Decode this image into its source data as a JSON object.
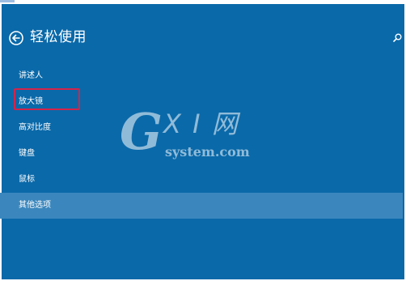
{
  "header": {
    "title": "轻松使用",
    "back_icon": "back-arrow-icon",
    "search_icon": "search-icon"
  },
  "menu": {
    "items": [
      {
        "label": "讲述人"
      },
      {
        "label": "放大镜"
      },
      {
        "label": "高对比度"
      },
      {
        "label": "键盘"
      },
      {
        "label": "鼠标"
      },
      {
        "label": "其他选项"
      }
    ],
    "selected_index": 5,
    "highlighted_index": 1
  },
  "watermark": {
    "logo_g": "G",
    "logo_xi": "X I 网",
    "domain": "system.com"
  },
  "colors": {
    "panel": "#0a69a9",
    "selected_row": "#3b87bd",
    "highlight_box": "#d3244a",
    "text": "#ffffff"
  }
}
